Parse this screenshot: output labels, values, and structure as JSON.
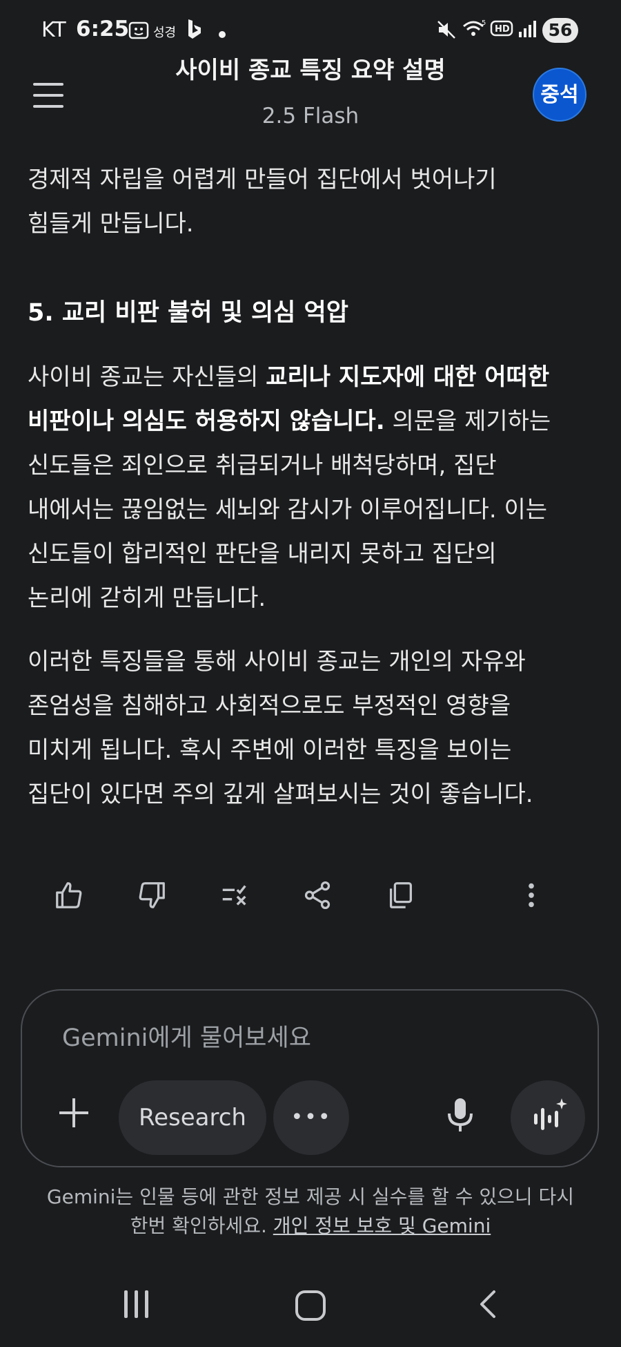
{
  "status_bar": {
    "carrier": "KT",
    "time": "6:25",
    "notif_text": "성경",
    "battery": "56"
  },
  "header": {
    "title": "사이비 종교 특징 요약 설명",
    "model": "2.5 Flash",
    "avatar_text": "중석"
  },
  "content": {
    "para1_lines": [
      "경제적 자립을 어렵게 만들어 집단에서 벗어나기",
      "힘들게 만듭니다."
    ],
    "heading": "5. 교리 비판 불허 및 의심 억압",
    "para2": {
      "l1_pre": "사이비 종교는 자신들의 ",
      "l1_bold": "교리나 지도자에 대한 어떠한",
      "l2_bold": "비판이나 의심도 허용하지 않습니다.",
      "l2_post": " 의문을 제기하는",
      "l3": "신도들은 죄인으로 취급되거나 배척당하며, 집단",
      "l4": "내에서는 끊임없는 세뇌와 감시가 이루어집니다. 이는",
      "l5": "신도들이 합리적인 판단을 내리지 못하고 집단의",
      "l6": "논리에 갇히게 만듭니다."
    },
    "para3_lines": [
      "이러한 특징들을 통해 사이비 종교는 개인의 자유와",
      "존엄성을 침해하고 사회적으로도 부정적인 영향을",
      "미치게 됩니다. 혹시 주변에 이러한 특징을 보이는",
      "집단이 있다면 주의 깊게 살펴보시는 것이 좋습니다."
    ]
  },
  "actions": [
    "thumbs-up-icon",
    "thumbs-down-icon",
    "double-check-icon",
    "share-icon",
    "copy-icon",
    "more-vert-icon"
  ],
  "input": {
    "placeholder": "Gemini에게 물어보세요",
    "research_label": "Research",
    "more_label": "•••"
  },
  "disclaimer": {
    "line1": "Gemini는 인물 등에 관한 정보 제공 시 실수를 할 수 있으니 다시",
    "line2_pre": "한번 확인하세요. ",
    "link": "개인 정보 보호 및 Gemini"
  },
  "colors": {
    "background": "#1b1c1e",
    "avatar": "#0b57d0",
    "chip": "#2b2d31"
  }
}
